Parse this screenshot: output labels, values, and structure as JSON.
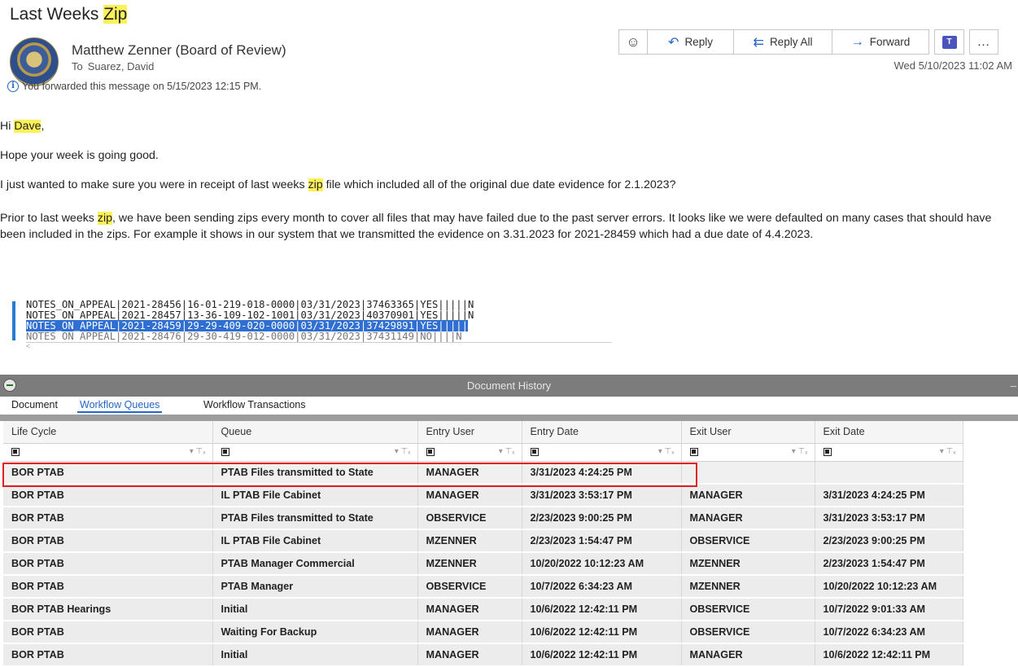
{
  "email": {
    "subject_prefix": "Last Weeks ",
    "subject_highlight": "Zip",
    "sender": "Matthew Zenner (Board of Review)",
    "to_label": "To",
    "to_value": "Suarez, David",
    "forwarded_notice": "You forwarded this message on 5/15/2023 12:15 PM.",
    "date": "Wed 5/10/2023 11:02 AM",
    "toolbar": {
      "reply": "Reply",
      "reply_all": "Reply All",
      "forward": "Forward",
      "more": "…"
    },
    "body": {
      "greeting_prefix": "Hi ",
      "greeting_name": "Dave",
      "greeting_suffix": ",",
      "line1": "Hope your week is going good.",
      "line2_prefix": "I just wanted to make sure you were in receipt of last weeks ",
      "line2_highlight": "zip",
      "line2_suffix": " file which included all of the original due date evidence for 2.1.2023?",
      "para3_prefix": "Prior to last weeks ",
      "para3_highlight": "zip",
      "para3_suffix": ", we have been sending zips every month to cover all files that may have failed due to the past server errors. It looks like we were defaulted on many cases that should have been included in the zips.  For example it shows in our system that we transmitted the evidence on 3.31.2023 for 2021-28459 which had a due date of 4.4.2023."
    },
    "snippet": {
      "line1": "NOTES_ON_APPEAL|2021-28456|16-01-219-018-0000|03/31/2023|37463365|YES|||||N",
      "line2": "NOTES_ON_APPEAL|2021-28457|13-36-109-102-1001|03/31/2023|40370901|YES|||||N",
      "line3": "NOTES_ON_APPEAL|2021-28459|29-29-409-020-0000|03/31/2023|37429891|YES|||||",
      "line4": "NOTES ON APPEAL|2021-28476|29-30-419-012-0000|03/31/2023|37431149|NO||||N"
    }
  },
  "history": {
    "title": "Document History",
    "tabs": [
      "Document",
      "Workflow Queues",
      "Workflow Transactions"
    ],
    "columns": [
      "Life Cycle",
      "Queue",
      "Entry User",
      "Entry Date",
      "Exit User",
      "Exit Date"
    ],
    "rows": [
      [
        "BOR PTAB",
        "PTAB Files transmitted to State",
        "MANAGER",
        "3/31/2023 4:24:25 PM",
        "",
        ""
      ],
      [
        "BOR PTAB",
        "IL PTAB File Cabinet",
        "MANAGER",
        "3/31/2023 3:53:17 PM",
        "MANAGER",
        "3/31/2023 4:24:25 PM"
      ],
      [
        "BOR PTAB",
        "PTAB Files transmitted to State",
        "OBSERVICE",
        "2/23/2023 9:00:25 PM",
        "MANAGER",
        "3/31/2023 3:53:17 PM"
      ],
      [
        "BOR PTAB",
        "IL PTAB File Cabinet",
        "MZENNER",
        "2/23/2023 1:54:47 PM",
        "OBSERVICE",
        "2/23/2023 9:00:25 PM"
      ],
      [
        "BOR PTAB",
        "PTAB Manager Commercial",
        "MZENNER",
        "10/20/2022 10:12:23 AM",
        "MZENNER",
        "2/23/2023 1:54:47 PM"
      ],
      [
        "BOR PTAB",
        "PTAB Manager",
        "OBSERVICE",
        "10/7/2022 6:34:23 AM",
        "MZENNER",
        "10/20/2022 10:12:23 AM"
      ],
      [
        "BOR PTAB Hearings",
        "Initial",
        "MANAGER",
        "10/6/2022 12:42:11 PM",
        "OBSERVICE",
        "10/7/2022 9:01:33 AM"
      ],
      [
        "BOR PTAB",
        "Waiting For Backup",
        "MANAGER",
        "10/6/2022 12:42:11 PM",
        "OBSERVICE",
        "10/7/2022 6:34:23 AM"
      ],
      [
        "BOR PTAB",
        "Initial",
        "MANAGER",
        "10/6/2022 12:42:11 PM",
        "MANAGER",
        "10/6/2022 12:42:11 PM"
      ]
    ]
  }
}
